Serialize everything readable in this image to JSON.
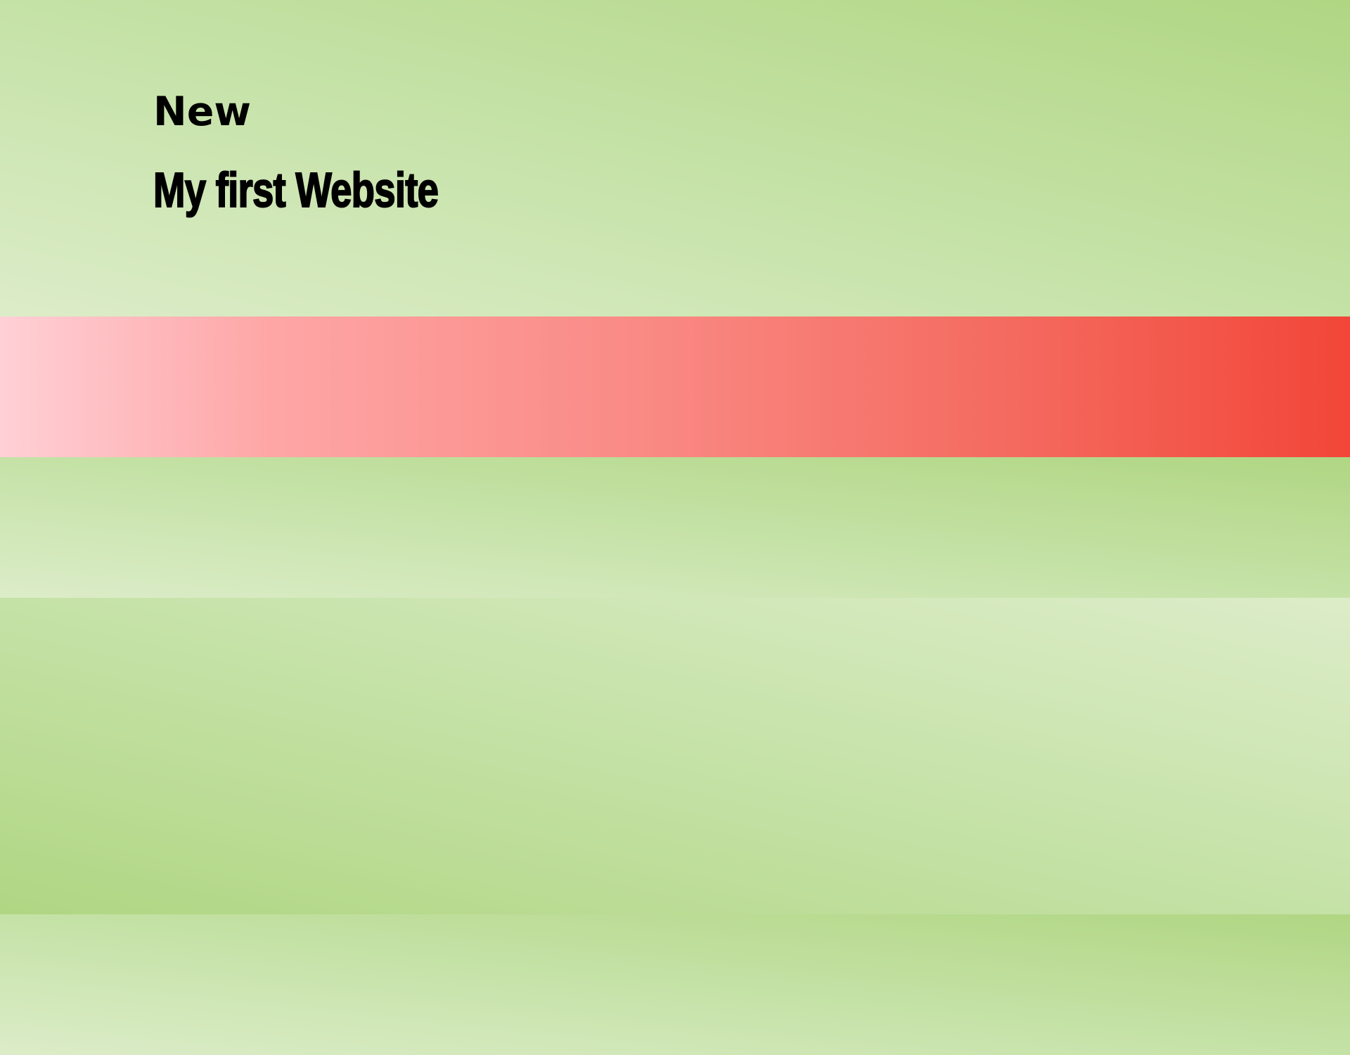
{
  "hero": {
    "eyebrow": "New",
    "title": "My first Website"
  },
  "colors": {
    "green_light": "#dcecc8",
    "green_mid": "#c7e3aa",
    "green_dark": "#b0d683",
    "red_light": "#ffd0d6",
    "red_dark": "#f24638",
    "text": "#000000"
  }
}
